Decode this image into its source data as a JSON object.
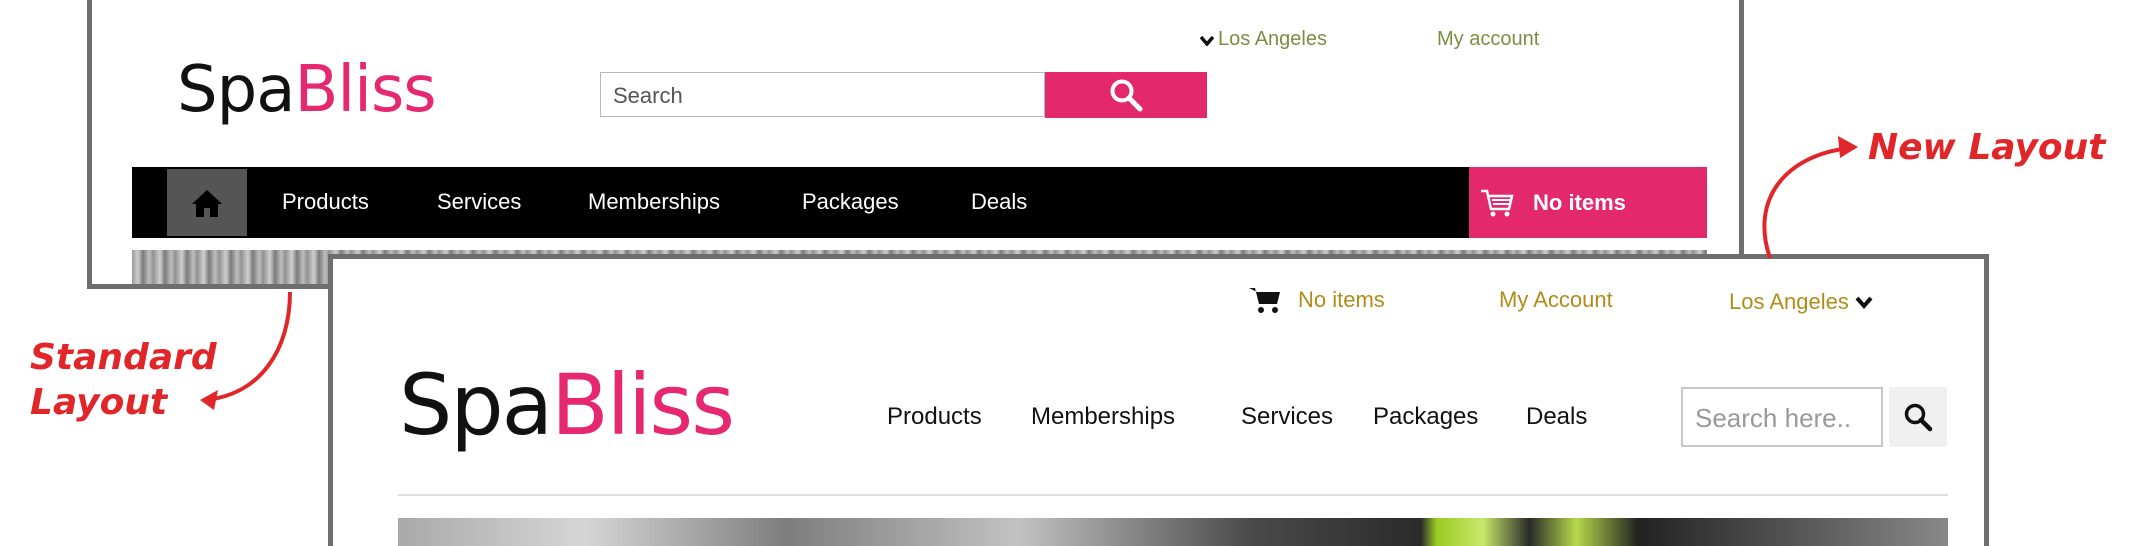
{
  "annotations": {
    "standard_label_line1": "Standard",
    "standard_label_line2": "Layout",
    "new_label": "New Layout"
  },
  "standard_layout": {
    "brand_part1": "Spa",
    "brand_part2": "Bliss",
    "location": "Los Angeles",
    "account_link": "My account",
    "search_placeholder": "Search",
    "nav_items": [
      "Products",
      "Services",
      "Memberships",
      "Packages",
      "Deals"
    ],
    "cart_label": "No items",
    "colors": {
      "accent": "#e3286c",
      "link": "#7b8f44",
      "nav_bg": "#000000"
    },
    "icons": [
      "chevron-down-icon",
      "search-icon",
      "home-icon",
      "cart-icon"
    ]
  },
  "new_layout": {
    "brand_part1": "Spa",
    "brand_part2": "Bliss",
    "cart_label": "No items",
    "account_link": "My Account",
    "location": "Los Angeles",
    "nav_items": [
      "Products",
      "Memberships",
      "Services",
      "Packages",
      "Deals"
    ],
    "search_placeholder": "Search here..",
    "colors": {
      "accent": "#e52870",
      "link": "#b08d1a"
    },
    "icons": [
      "cart-icon",
      "chevron-down-icon",
      "search-icon"
    ]
  }
}
